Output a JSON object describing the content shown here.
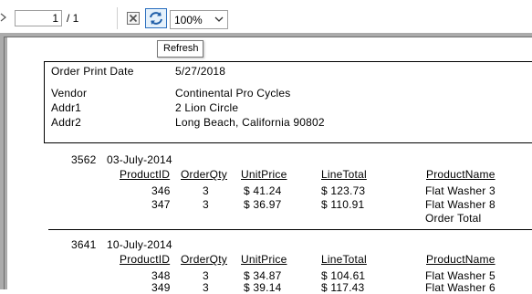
{
  "toolbar": {
    "page_current": "1",
    "page_total": "/ 1",
    "zoom": "100%",
    "tooltip": "Refresh"
  },
  "report": {
    "header": {
      "order_print_date_label": "Order Print Date",
      "order_print_date_value": "5/27/2018",
      "vendor_label": "Vendor",
      "vendor_value": "Continental Pro Cycles",
      "addr1_label": "Addr1",
      "addr1_value": "2 Lion Circle",
      "addr2_label": "Addr2",
      "addr2_value": "Long Beach, California 90802"
    },
    "columns": [
      "ProductID",
      "OrderQty",
      "UnitPrice",
      "LineTotal",
      "ProductName"
    ],
    "orders": [
      {
        "id": "3562",
        "date": "03-July-2014",
        "rows": [
          {
            "product_id": "346",
            "qty": "3",
            "unit_price": "$ 41.24",
            "line_total": "$ 123.73",
            "name": "Flat Washer 3"
          },
          {
            "product_id": "347",
            "qty": "3",
            "unit_price": "$ 36.97",
            "line_total": "$ 110.91",
            "name": "Flat Washer 8"
          }
        ],
        "order_total_label": "Order Total"
      },
      {
        "id": "3641",
        "date": "10-July-2014",
        "rows": [
          {
            "product_id": "348",
            "qty": "3",
            "unit_price": "$ 34.87",
            "line_total": "$ 104.61",
            "name": "Flat Washer 5"
          },
          {
            "product_id": "349",
            "qty": "3",
            "unit_price": "$ 39.14",
            "line_total": "$ 117.43",
            "name": "Flat Washer 6"
          }
        ]
      }
    ]
  }
}
